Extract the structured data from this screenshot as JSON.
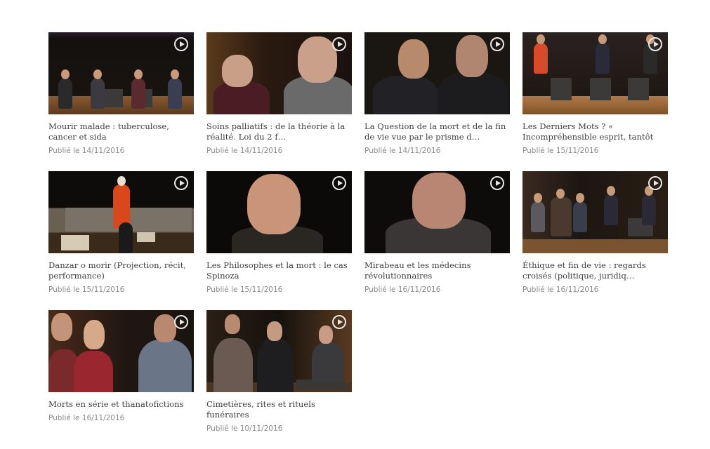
{
  "videos": [
    {
      "title": "Mourir malade : tuberculose, cancer et sida",
      "date": "Publié le 14/11/2016"
    },
    {
      "title": "Soins palliatifs : de la théorie à la réalité. Loi du 2 f…",
      "date": "Publié le 14/11/2016"
    },
    {
      "title": "La Question de la mort et de la fin de vie vue par le prisme d…",
      "date": "Publié le 14/11/2016"
    },
    {
      "title": "Les Derniers Mots ? « Incompréhensible esprit, tantôt",
      "date": "Publié le 15/11/2016"
    },
    {
      "title": "Danzar o morir (Projection, récit, performance)",
      "date": "Publié le 15/11/2016"
    },
    {
      "title": "Les Philosophes et la mort : le cas Spinoza",
      "date": "Publié le 15/11/2016"
    },
    {
      "title": "Mirabeau et les médecins révolutionnaires",
      "date": "Publié le 16/11/2016"
    },
    {
      "title": "Éthique et fin de vie : regards croisés (politique, juridiq…",
      "date": "Publié le 16/11/2016"
    },
    {
      "title": "Morts en série et thanatofictions",
      "date": "Publié le 16/11/2016"
    },
    {
      "title": "Cimetières, rites et rituels funéraires",
      "date": "Publié le 10/11/2016"
    }
  ],
  "icons": {
    "play": "play-circle-icon"
  }
}
